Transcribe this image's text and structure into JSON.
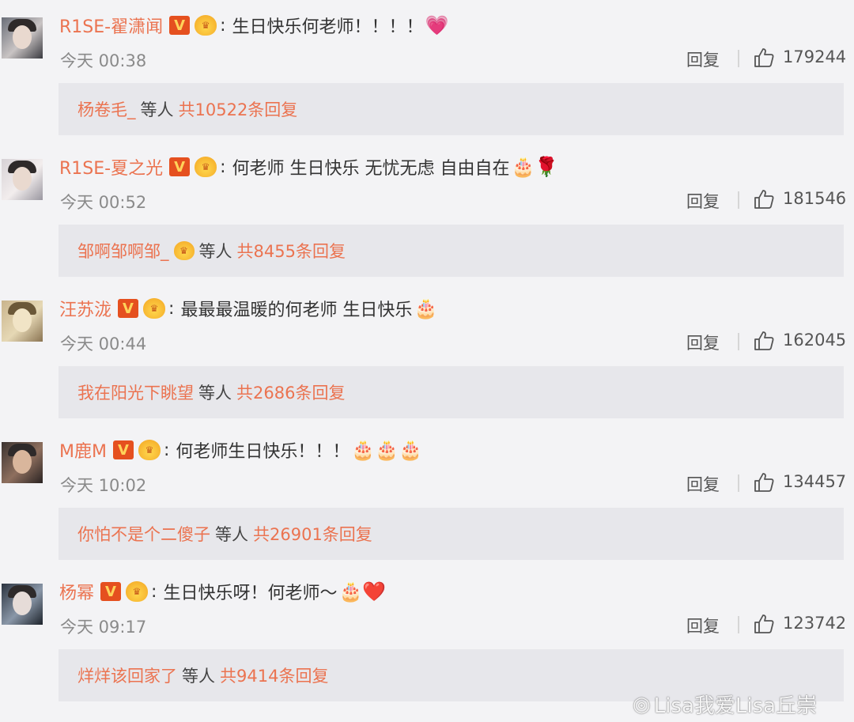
{
  "comments": [
    {
      "username": "R1SE-翟潇闻",
      "badge": "V",
      "colon": ":",
      "text": "生日快乐何老师！！！！",
      "emoji": "💗",
      "time": "今天 00:38",
      "reply_label": "回复",
      "likes": "179244",
      "reply_user": "杨卷毛_",
      "reply_mid": "等人",
      "reply_total": "共10522条回复",
      "reply_user_has_crown": false
    },
    {
      "username": "R1SE-夏之光",
      "badge": "V",
      "colon": ":",
      "text": "何老师 生日快乐 无忧无虑 自由自在",
      "emoji": "🎂🌹",
      "time": "今天 00:52",
      "reply_label": "回复",
      "likes": "181546",
      "reply_user": "邹啊邹啊邹_",
      "reply_mid": "等人",
      "reply_total": "共8455条回复",
      "reply_user_has_crown": true
    },
    {
      "username": "汪苏泷",
      "badge": "V",
      "colon": ":",
      "text": "最最最温暖的何老师 生日快乐",
      "emoji": "🎂",
      "time": "今天 00:44",
      "reply_label": "回复",
      "likes": "162045",
      "reply_user": "我在阳光下眺望",
      "reply_mid": "等人",
      "reply_total": "共2686条回复",
      "reply_user_has_crown": false
    },
    {
      "username": "M鹿M",
      "badge": "V",
      "colon": ":",
      "text": "何老师生日快乐！！！",
      "emoji": "🎂🎂🎂",
      "time": "今天 10:02",
      "reply_label": "回复",
      "likes": "134457",
      "reply_user": "你怕不是个二傻子",
      "reply_mid": "等人",
      "reply_total": "共26901条回复",
      "reply_user_has_crown": false
    },
    {
      "username": "杨幂",
      "badge": "V",
      "colon": ":",
      "text": "生日快乐呀！何老师～",
      "emoji": "🎂❤️",
      "time": "今天 09:17",
      "reply_label": "回复",
      "likes": "123742",
      "reply_user": "烊烊该回家了",
      "reply_mid": "等人",
      "reply_total": "共9414条回复",
      "reply_user_has_crown": false
    }
  ],
  "watermark": {
    "text": "Lisa我爱Lisa丘崇"
  },
  "colors": {
    "username": "#eb7350",
    "background": "#f3f3f5",
    "reply_box": "#e7e7eb",
    "v_badge": "#e5501f"
  }
}
